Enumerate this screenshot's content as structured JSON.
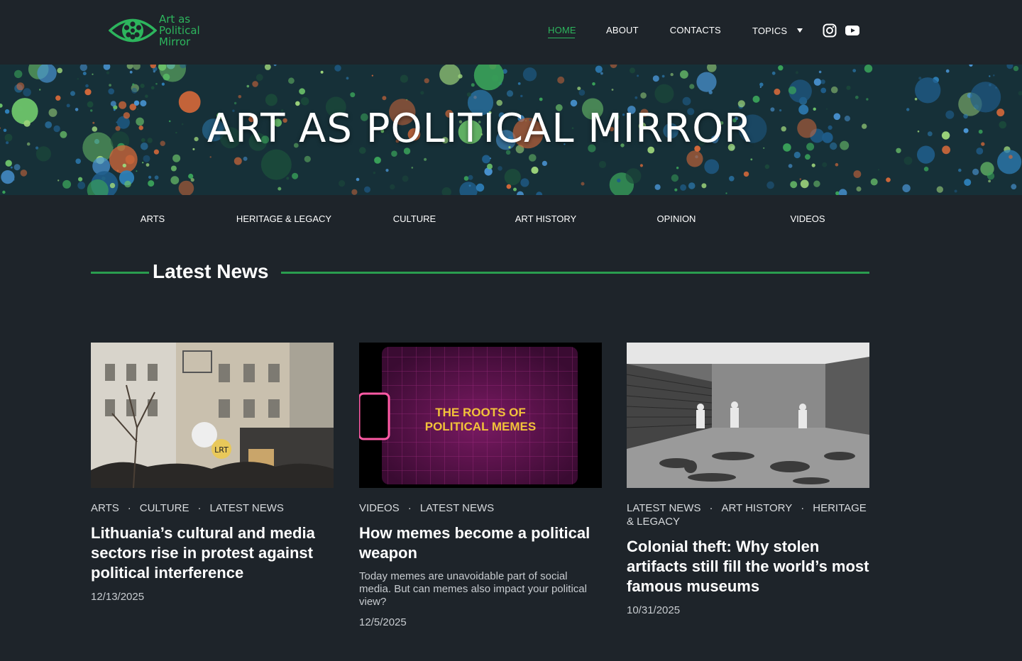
{
  "brand": {
    "logo_lines": [
      "Art as",
      "Political",
      "Mirror"
    ],
    "accent_color": "#2db55d"
  },
  "nav": {
    "home": "HOME",
    "about": "ABOUT",
    "contacts": "CONTACTS",
    "topics": "TOPICS",
    "social_icons": [
      "instagram-icon",
      "youtube-icon"
    ]
  },
  "hero": {
    "title": "ART AS POLITICAL MIRROR"
  },
  "categories": [
    "ARTS",
    "HERITAGE & LEGACY",
    "CULTURE",
    "ART HISTORY",
    "OPINION",
    "VIDEOS"
  ],
  "section": {
    "title": "Latest News"
  },
  "articles": [
    {
      "tags": [
        "ARTS",
        "CULTURE",
        "LATEST NEWS"
      ],
      "title": "Lithuania’s cultural and media sectors rise in protest against political interference",
      "excerpt": "",
      "date": "12/13/2025"
    },
    {
      "tags": [
        "VIDEOS",
        "LATEST NEWS"
      ],
      "thumb_text": [
        "THE ROOTS OF",
        "POLITICAL MEMES"
      ],
      "title": "How memes become a political weapon",
      "excerpt": "Today memes are unavoidable part of social media. But can memes also impact your political view?",
      "date": "12/5/2025"
    },
    {
      "tags": [
        "LATEST NEWS",
        "ART HISTORY",
        "HERITAGE & LEGACY"
      ],
      "title": "Colonial theft: Why stolen artifacts still fill the world’s most famous museums",
      "excerpt": "",
      "date": "10/31/2025"
    }
  ]
}
